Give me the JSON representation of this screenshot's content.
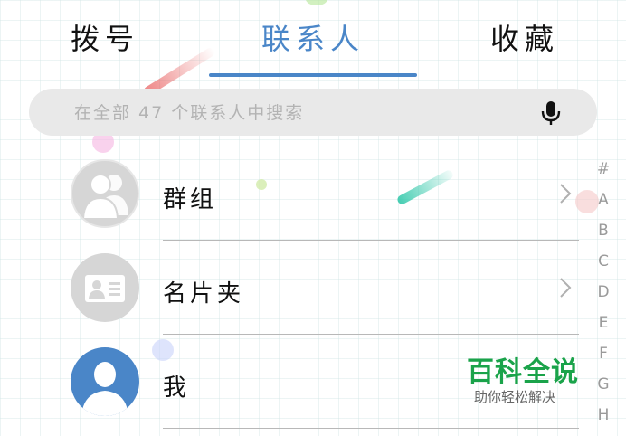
{
  "tabs": [
    {
      "label": "拨号",
      "active": false
    },
    {
      "label": "联系人",
      "active": true
    },
    {
      "label": "收藏",
      "active": false
    }
  ],
  "search": {
    "placeholder": "在全部 47 个联系人中搜索"
  },
  "list": [
    {
      "label": "群组",
      "icon": "group-avatar-icon",
      "has_chevron": true
    },
    {
      "label": "名片夹",
      "icon": "business-card-icon",
      "has_chevron": true
    },
    {
      "label": "我",
      "icon": "user-avatar-icon",
      "has_chevron": false
    }
  ],
  "index_letters": [
    "#",
    "A",
    "B",
    "C",
    "D",
    "E",
    "F",
    "G",
    "H"
  ],
  "watermark": {
    "title": "百科全说",
    "subtitle": "助你轻松解决"
  },
  "colors": {
    "accent": "#4a86c8",
    "watermark": "#1aa34a",
    "avatar_gray": "#d6d6d6"
  }
}
